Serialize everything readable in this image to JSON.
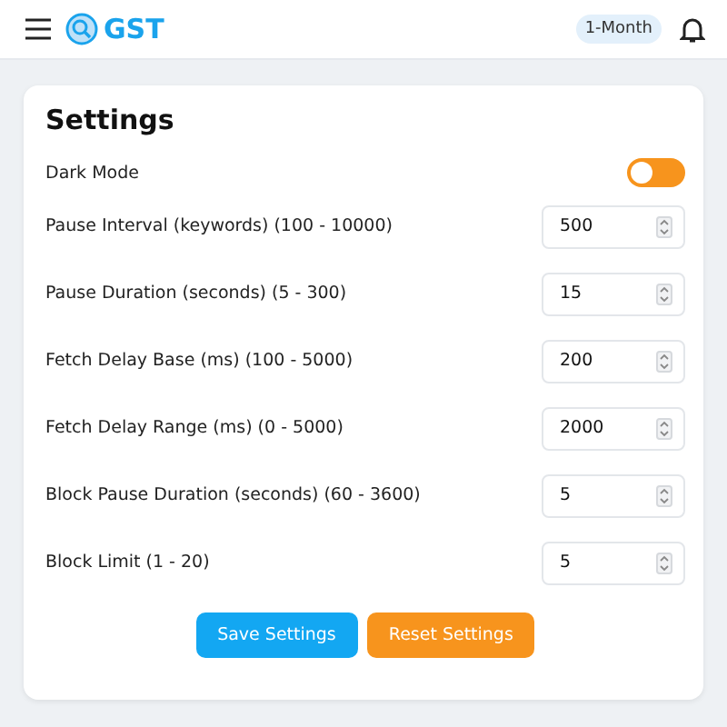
{
  "header": {
    "logo": "GST",
    "plan_badge": "1-Month"
  },
  "settings": {
    "title": "Settings",
    "dark_mode": {
      "label": "Dark Mode",
      "on": false
    },
    "fields": [
      {
        "label": "Pause Interval (keywords) (100 - 10000)",
        "value": "500"
      },
      {
        "label": "Pause Duration (seconds) (5 - 300)",
        "value": "15"
      },
      {
        "label": "Fetch Delay Base (ms) (100 - 5000)",
        "value": "200"
      },
      {
        "label": "Fetch Delay Range (ms) (0 - 5000)",
        "value": "2000"
      },
      {
        "label": "Block Pause Duration (seconds) (60 - 3600)",
        "value": "5"
      },
      {
        "label": "Block Limit (1 - 20)",
        "value": "5"
      }
    ],
    "buttons": [
      {
        "label": "Save Settings",
        "kind": "primary"
      },
      {
        "label": "Reset Settings",
        "kind": "reset"
      }
    ]
  }
}
